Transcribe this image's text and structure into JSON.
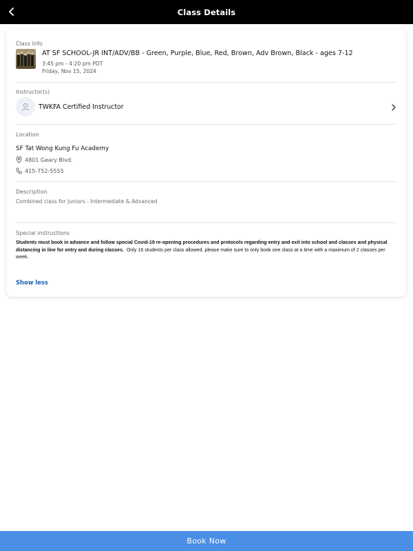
{
  "header": {
    "title": "Class Details",
    "back_icon": "chevron-left-icon"
  },
  "class_info": {
    "label": "Class Info",
    "title": "AT SF SCHOOL-JR INT/ADV/BB - Green, Purple, Blue, Red, Brown, Adv Brown, Black - ages 7-12",
    "time": "3:45 pm - 4:20 pm PDT",
    "date": "Friday, Nov 15, 2024"
  },
  "instructors": {
    "label": "Instructor(s)",
    "name": "TWKFA Certified Instructor"
  },
  "location": {
    "label": "Location",
    "name": "SF Tat Wong Kung Fu Academy",
    "address": "4801 Geary Blvd.",
    "phone": "415-752-5555"
  },
  "description": {
    "label": "Description",
    "text": "Combined class for Juniors - Intermediate & Advanced"
  },
  "special_instructions": {
    "label": "Special instructions",
    "bold_text": "Students must book in advance and follow special Covid-19 re-opening procedures and protocols regarding entry and exit into school and classes and physical distancing in line for entry and during classes.",
    "normal_text": "  Only 16 students per class allowed, please make sure to only book one class at a time with a maximum of 2 classes per week."
  },
  "toggle": {
    "show_less": "Show less"
  },
  "footer": {
    "book_now": "Book Now"
  },
  "colors": {
    "header_bg": "#000000",
    "accent": "#1f5fb4",
    "button_bg": "#4b8ee6"
  }
}
